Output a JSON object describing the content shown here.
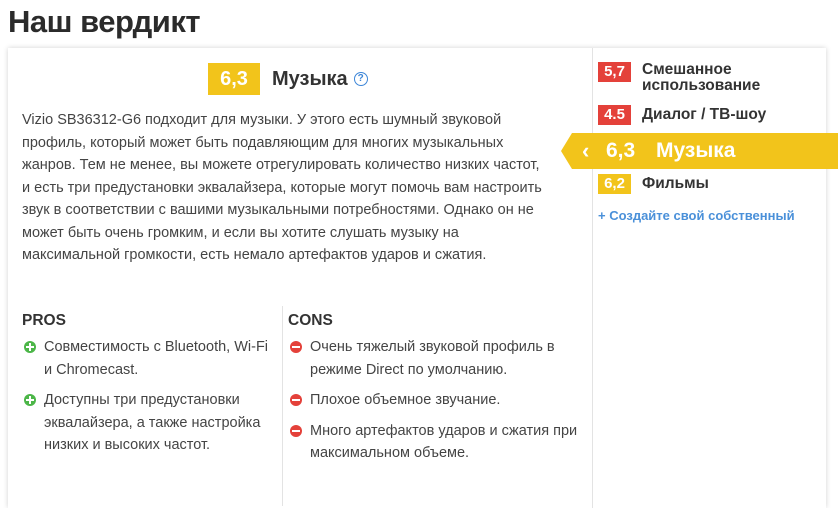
{
  "page": {
    "title": "Наш вердикт"
  },
  "usage": {
    "score": "6,3",
    "name": "Музыка",
    "help_icon": "question-circle-icon",
    "description": "Vizio SB36312-G6 подходит для музыки. У этого есть шумный звуковой профиль, который может быть подавляющим для многих музыкальных жанров. Тем не менее, вы можете отрегулировать количество низких частот, и есть три предустановки эквалайзера, которые могут помочь вам настроить звук в соответствии с вашими музыкальными потребностями. Однако он не может быть очень громким, и если вы хотите слушать музыку на максимальной громкости, есть немало артефактов ударов и сжатия."
  },
  "pros": {
    "heading": "PROS",
    "items": [
      "Совместимость с Bluetooth, Wi-Fi и Chromecast.",
      "Доступны три предустановки эквалайзера, а также настройка низких и высоких частот."
    ]
  },
  "cons": {
    "heading": "CONS",
    "items": [
      "Очень тяжелый звуковой профиль в режиме Direct по умолчанию.",
      "Плохое объемное звучание.",
      "Много артефактов ударов и сжатия при максимальном объеме."
    ]
  },
  "sidebar": {
    "items": [
      {
        "score": "5,7",
        "label": "Смешанное использование",
        "color": "#e4413a"
      },
      {
        "score": "4.5",
        "label": "Диалог / ТВ-шоу",
        "color": "#e4413a"
      },
      {
        "score": "6,3",
        "label": "Музыка",
        "color": "#f2c41b",
        "active": true
      },
      {
        "score": "6,2",
        "label": "Фильмы",
        "color": "#f2c41b"
      }
    ],
    "create_link": "+ Создайте свой собственный"
  },
  "colors": {
    "yellow": "#f2c41b",
    "red": "#e4413a",
    "green": "#4cb648",
    "link": "#4a90d9"
  }
}
